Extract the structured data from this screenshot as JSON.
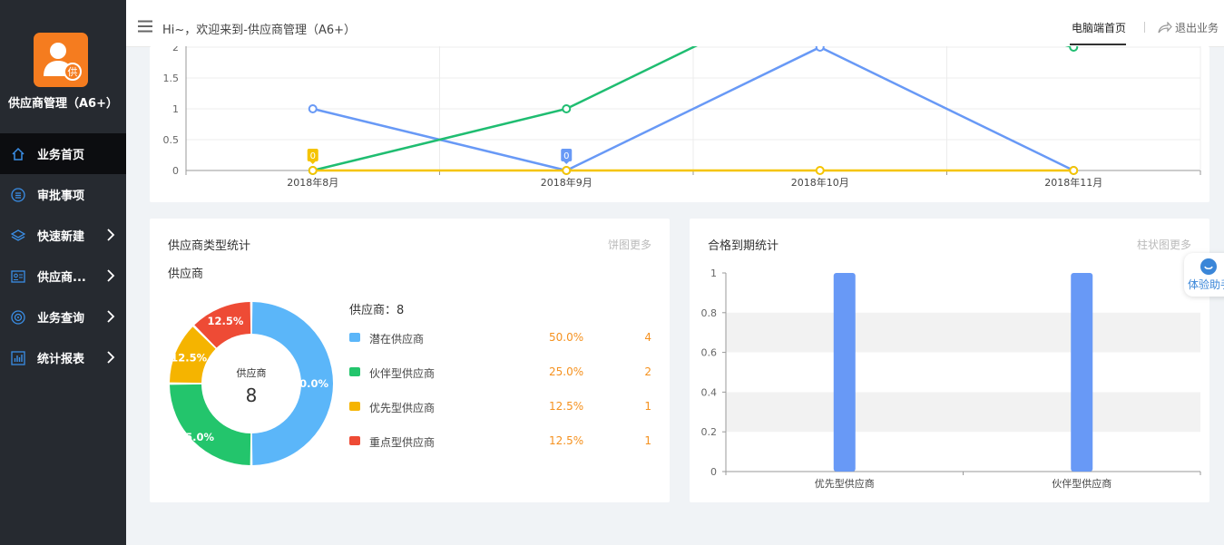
{
  "sidebar": {
    "app_name": "供应商管理（A6+）",
    "logo_char": "供",
    "items": [
      {
        "label": "业务首页",
        "icon": "home-icon"
      },
      {
        "label": "审批事项",
        "icon": "list-icon"
      },
      {
        "label": "快速新建",
        "icon": "layers-icon"
      },
      {
        "label": "供应商...",
        "icon": "id-card-icon"
      },
      {
        "label": "业务查询",
        "icon": "target-icon"
      },
      {
        "label": "统计报表",
        "icon": "bar-chart-icon"
      }
    ]
  },
  "header": {
    "greeting": "Hi~，欢迎来到-供应商管理（A6+）",
    "tab_label": "电脑端首页",
    "logout_label": "退出业务"
  },
  "assistant": {
    "label": "体验助手"
  },
  "type_card": {
    "title": "供应商类型统计",
    "more": "饼图更多",
    "subtitle": "供应商",
    "center_label": "供应商",
    "center_value": "8",
    "legend_total": "供应商：8"
  },
  "expiry_card": {
    "title": "合格到期统计",
    "more": "柱状图更多"
  },
  "colors": {
    "blue": "#6899f6",
    "green": "#1fbd71",
    "yellow": "#f5c400",
    "pie_blue": "#5bb6f9",
    "pie_green": "#23c56c",
    "pie_yellow": "#f5b400",
    "pie_red": "#ee4b35",
    "accent_orange": "#f5911e"
  },
  "chart_data": [
    {
      "type": "line",
      "x": [
        "2018年8月",
        "2018年9月",
        "2018年10月",
        "2018年11月"
      ],
      "ylim": [
        0,
        2
      ],
      "yticks": [
        "0",
        "0.5",
        "1",
        "1.5",
        "2"
      ],
      "series": [
        {
          "values": [
            1,
            0,
            2,
            0
          ],
          "color": "#6899f6"
        },
        {
          "values": [
            0,
            1,
            3,
            2
          ],
          "color": "#1fbd71"
        },
        {
          "values": [
            0,
            0,
            0,
            0
          ],
          "color": "#f5c400"
        }
      ],
      "annotations": [
        {
          "text": "0",
          "x": "2018年8月",
          "color": "#f5c400"
        },
        {
          "text": "0",
          "x": "2018年9月",
          "color": "#6899f6"
        }
      ]
    },
    {
      "type": "pie",
      "categories": [
        "潜在供应商",
        "伙伴型供应商",
        "优先型供应商",
        "重点型供应商"
      ],
      "values": [
        4,
        2,
        1,
        1
      ],
      "percent_labels": [
        "50.0%",
        "25.0%",
        "12.5%",
        "12.5%"
      ],
      "colors": [
        "#5bb6f9",
        "#23c56c",
        "#f5b400",
        "#ee4b35"
      ]
    },
    {
      "type": "bar",
      "categories": [
        "优先型供应商",
        "伙伴型供应商"
      ],
      "values": [
        1,
        1
      ],
      "ylim": [
        0,
        1
      ],
      "yticks": [
        "0",
        "0.2",
        "0.4",
        "0.6",
        "0.8",
        "1"
      ],
      "color": "#6899f6"
    }
  ]
}
